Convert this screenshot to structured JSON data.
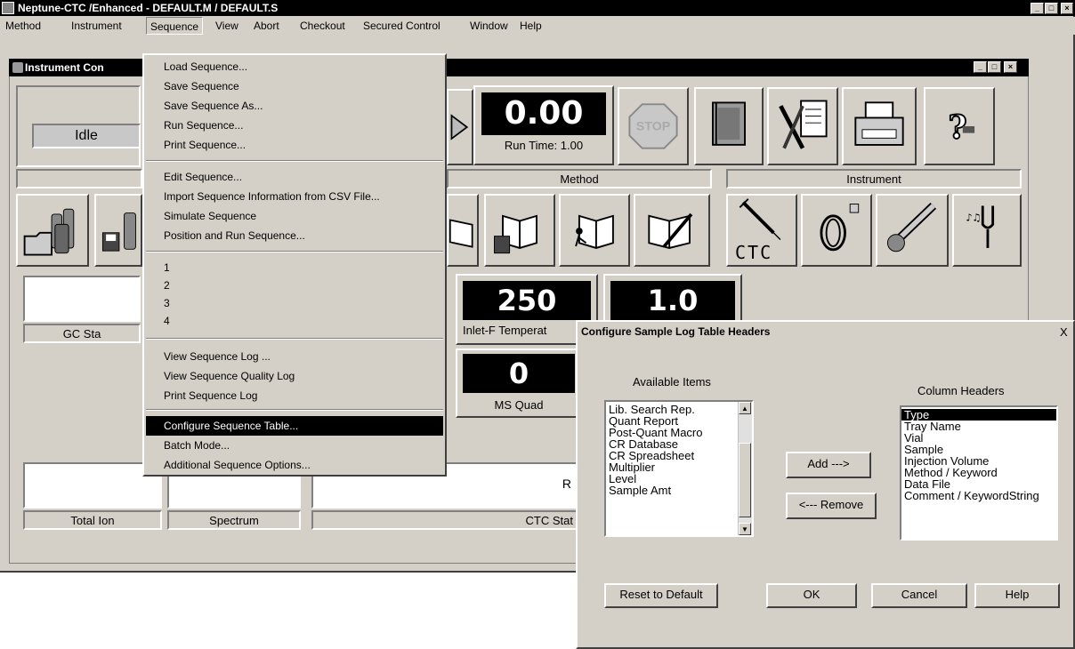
{
  "app": {
    "title": "Neptune-CTC /Enhanced - DEFAULT.M / DEFAULT.S",
    "menu": [
      "Method",
      "Instrument",
      "Sequence",
      "View",
      "Abort",
      "Checkout",
      "Secured Control",
      "Window",
      "Help"
    ]
  },
  "inner_window": {
    "title": "Instrument Con",
    "status": "Idle",
    "run_value": "0.00",
    "run_time_label": "Run Time: 1.00",
    "stop_label": "STOP",
    "method_header": "Method",
    "instrument_header": "Instrument",
    "ctc_label": "CTC",
    "gc_status_label": "GC Sta",
    "inlet_value": "250",
    "inlet_label": "Inlet-F Temperat",
    "value_1": "1.0",
    "ms_quad_value": "0",
    "ms_quad_label": "MS Quad",
    "total_ion_label": "Total Ion",
    "spectrum_label": "Spectrum",
    "ctc_status_label": "CTC Stat",
    "ctc_status_partial": "R"
  },
  "sequence_menu": {
    "group1": [
      "Load Sequence...",
      "Save Sequence",
      "Save Sequence As...",
      "Run Sequence...",
      "Print Sequence..."
    ],
    "group2": [
      "Edit Sequence...",
      "Import Sequence Information from CSV File...",
      "Simulate Sequence",
      "Position and Run Sequence..."
    ],
    "group3": [
      "1",
      "2",
      "3",
      "4"
    ],
    "group4": [
      "View Sequence Log ...",
      "View Sequence Quality Log",
      "Print Sequence Log"
    ],
    "group5": [
      "Configure Sequence Table...",
      "Batch Mode...",
      "Additional Sequence Options..."
    ]
  },
  "dialog": {
    "title": "Configure Sample Log Table Headers",
    "close": "X",
    "available_label": "Available Items",
    "column_label": "Column Headers",
    "available_items": [
      "Lib. Search Rep.",
      "Quant Report",
      "Post-Quant Macro",
      "CR Database",
      "CR Spreadsheet",
      "Multiplier",
      "Level",
      "Sample Amt"
    ],
    "column_headers": [
      "Type",
      "Tray Name",
      "Vial",
      "Sample",
      "Injection Volume",
      "Method / Keyword",
      "Data File",
      "Comment / KeywordString"
    ],
    "add_button": "Add --->",
    "remove_button": "<--- Remove",
    "reset_button": "Reset to Default",
    "ok_button": "OK",
    "cancel_button": "Cancel",
    "help_button": "Help"
  }
}
